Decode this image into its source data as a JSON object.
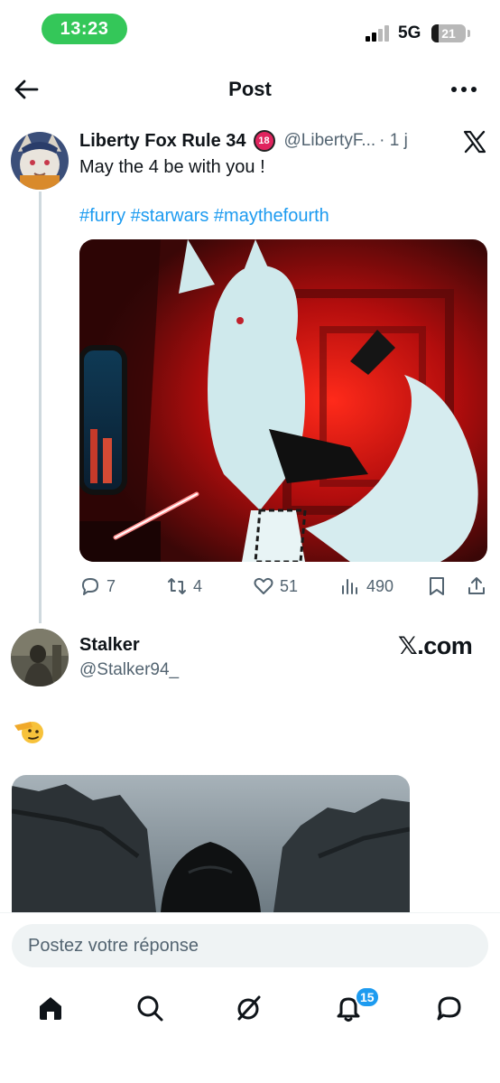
{
  "status_bar": {
    "time": "13:23",
    "network": "5G",
    "battery": "21",
    "battery_level": 0.21
  },
  "header": {
    "title": "Post",
    "back_icon": "arrow-left-icon",
    "more_icon": "more-horizontal-icon"
  },
  "tweet": {
    "display_name": "Liberty Fox Rule 34",
    "badge": "18",
    "handle": "@LibertyF...",
    "time": "· 1 j",
    "text": "May the 4 be with you !",
    "hashtags": "#furry #starwars #maythefourth",
    "stats": {
      "replies": "7",
      "retweets": "4",
      "likes": "51",
      "views": "490"
    }
  },
  "reply_tweet": {
    "display_name": "Stalker",
    "handle": "@Stalker94_",
    "source_label": "𝕏.com",
    "emoji": "🫡"
  },
  "reply_box": {
    "placeholder": "Postez votre réponse"
  },
  "bottom_nav": {
    "items": [
      "home-icon",
      "search-icon",
      "grok-icon",
      "notifications-icon",
      "messages-icon"
    ],
    "notifications_badge": "15"
  },
  "colors": {
    "accent": "#1d9bf0",
    "status_pill": "#34c759",
    "text_secondary": "#536471"
  }
}
